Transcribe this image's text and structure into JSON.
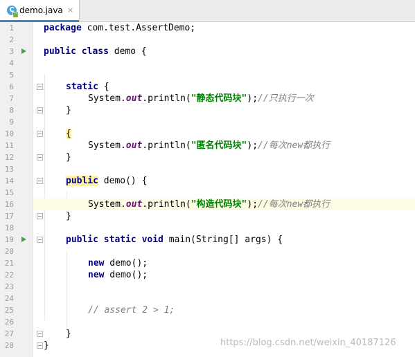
{
  "tab": {
    "filename": "demo.java",
    "icon_letter": "C",
    "close": "×"
  },
  "lines": [
    {
      "n": "1",
      "code": "package com.test.AssertDemo;"
    },
    {
      "n": "2",
      "code": ""
    },
    {
      "n": "3",
      "code": "public class demo {"
    },
    {
      "n": "4",
      "code": ""
    },
    {
      "n": "5",
      "code": ""
    },
    {
      "n": "6",
      "code": "static {"
    },
    {
      "n": "7",
      "s1": "System.",
      "fld": "out",
      "s2": ".println(",
      "str": "\"静态代码块\"",
      "s3": ");",
      "cmt": "//只执行一次"
    },
    {
      "n": "8",
      "code": "}"
    },
    {
      "n": "9",
      "code": ""
    },
    {
      "n": "10",
      "code": "{"
    },
    {
      "n": "11",
      "s1": "System.",
      "fld": "out",
      "s2": ".println(",
      "str": "\"匿名代码块\"",
      "s3": ");",
      "cmt": "//每次new都执行"
    },
    {
      "n": "12",
      "code": "}"
    },
    {
      "n": "13",
      "code": ""
    },
    {
      "n": "14",
      "code": "public demo() {"
    },
    {
      "n": "15",
      "code": ""
    },
    {
      "n": "16",
      "s1": "System.",
      "fld": "out",
      "s2": ".println(",
      "str": "\"构造代码块\"",
      "s3": ");",
      "cmt": "//每次new都执行"
    },
    {
      "n": "17",
      "code": "}"
    },
    {
      "n": "18",
      "code": ""
    },
    {
      "n": "19",
      "code": "public static void main(String[] args) {"
    },
    {
      "n": "20",
      "code": ""
    },
    {
      "n": "21",
      "code": "new demo();"
    },
    {
      "n": "22",
      "code": "new demo();"
    },
    {
      "n": "23",
      "code": ""
    },
    {
      "n": "24",
      "code": ""
    },
    {
      "n": "25",
      "code": "// assert 2 > 1;"
    },
    {
      "n": "26",
      "code": ""
    },
    {
      "n": "27",
      "code": "}"
    },
    {
      "n": "28",
      "code": "}"
    }
  ],
  "watermark": "https://blog.csdn.net/weixin_40187126",
  "colors": {
    "keyword": "#000080",
    "string": "#008000",
    "field": "#660e7a",
    "comment": "#808080",
    "run_icon": "#49a04a",
    "current_line": "#fdfbe3",
    "tab_accent": "#4083c9"
  }
}
